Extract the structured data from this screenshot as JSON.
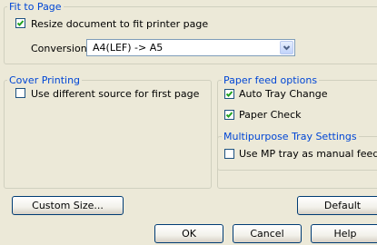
{
  "fit_to_page": {
    "legend": "Fit to Page",
    "resize_label": "Resize document to fit printer page",
    "resize_checked": true,
    "conversion_label": "Conversion:",
    "conversion_value": "A4(LEF) -> A5"
  },
  "cover_printing": {
    "legend": "Cover Printing",
    "different_source_label": "Use different source for first page",
    "different_source_checked": false
  },
  "paper_feed": {
    "legend": "Paper feed options",
    "auto_tray_label": "Auto Tray Change",
    "auto_tray_checked": true,
    "paper_check_label": "Paper Check",
    "paper_check_checked": true
  },
  "mp_tray": {
    "legend": "Multipurpose Tray Settings",
    "manual_feed_label": "Use MP tray as manual feed",
    "manual_feed_checked": false
  },
  "buttons": {
    "custom_size": "Custom Size...",
    "default": "Default",
    "ok": "OK",
    "cancel": "Cancel",
    "help": "Help"
  }
}
